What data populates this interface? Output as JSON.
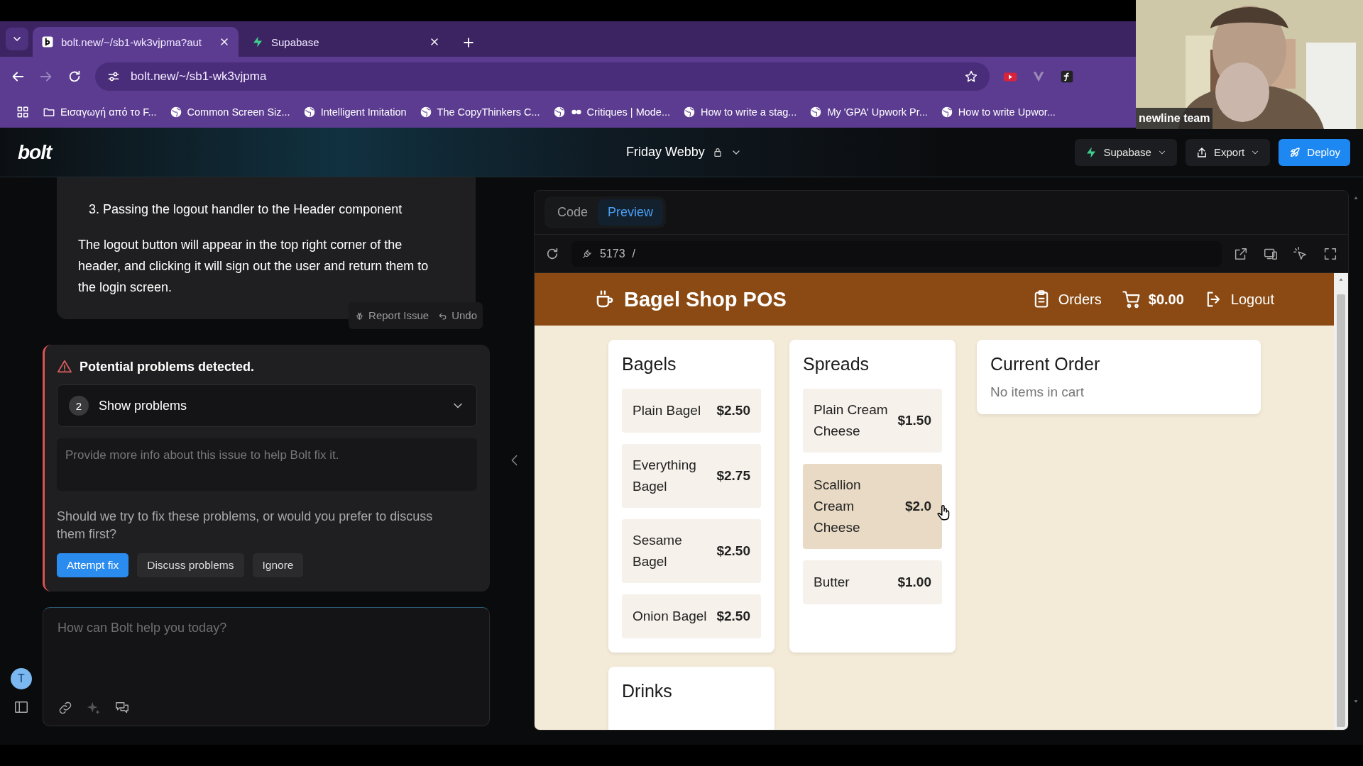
{
  "browser": {
    "tabs": [
      {
        "title": "bolt.new/~/sb1-wk3vjpma?aut",
        "kind": "bolt",
        "selected": true
      },
      {
        "title": "Supabase",
        "kind": "supabase",
        "selected": false
      }
    ],
    "address": "bolt.new/~/sb1-wk3vjpma",
    "bookmarks": [
      {
        "label": "Εισαγωγή από το F...",
        "kind": "folder"
      },
      {
        "label": "Common Screen Siz...",
        "kind": "globe"
      },
      {
        "label": "Intelligent Imitation",
        "kind": "globe"
      },
      {
        "label": "The CopyThinkers C...",
        "kind": "globe"
      },
      {
        "label": "Critiques | Mode...",
        "kind": "globe-mask"
      },
      {
        "label": "How to write a stag...",
        "kind": "globe"
      },
      {
        "label": "My 'GPA' Upwork Pr...",
        "kind": "globe"
      },
      {
        "label": "How to write Upwor...",
        "kind": "globe"
      }
    ]
  },
  "webcam": {
    "kind": "picture",
    "caption": "newline team"
  },
  "header": {
    "logo": "bolt",
    "project": "Friday Webby",
    "buttons": [
      {
        "label": "Supabase",
        "kind": "supabase"
      },
      {
        "label": "Export",
        "kind": "export"
      },
      {
        "label": "Deploy",
        "kind": "deploy"
      }
    ]
  },
  "chat": {
    "message": {
      "list_item": "3. Passing the logout handler to the Header component",
      "paragraph": "The logout button will appear in the top right corner of the header, and clicking it will sign out the user and return them to the login screen.",
      "actions": [
        {
          "label": "Report Issue",
          "kind": "report"
        },
        {
          "label": "Undo",
          "kind": "undo"
        }
      ]
    },
    "alert": {
      "title": "Potential problems detected.",
      "count": "2",
      "toggle": "Show problems",
      "expanded": false,
      "placeholder": "Provide more info about this issue to help Bolt fix it.",
      "question": "Should we try to fix these problems, or would you prefer to discuss them first?",
      "buttons": [
        {
          "label": "Attempt fix",
          "primary": true
        },
        {
          "label": "Discuss problems",
          "primary": false
        },
        {
          "label": "Ignore",
          "primary": false
        }
      ]
    },
    "input": {
      "placeholder": "How can Bolt help you today?"
    },
    "avatar": "T"
  },
  "workbench": {
    "tabs": [
      {
        "label": "Code",
        "selected": false
      },
      {
        "label": "Preview",
        "selected": true
      }
    ],
    "port": "5173",
    "path": "/",
    "app": {
      "title": "Bagel Shop POS",
      "nav": [
        {
          "label": "Orders",
          "kind": "orders"
        },
        {
          "label": "$0.00",
          "kind": "cart"
        },
        {
          "label": "Logout",
          "kind": "logout"
        }
      ],
      "menu": [
        {
          "title": "Bagels",
          "items": [
            {
              "name": "Plain Bagel",
              "price": "$2.50",
              "hovered": false
            },
            {
              "name": "Everything Bagel",
              "price": "$2.75",
              "hovered": false
            },
            {
              "name": "Sesame Bagel",
              "price": "$2.50",
              "hovered": false
            },
            {
              "name": "Onion Bagel",
              "price": "$2.50",
              "hovered": false
            }
          ]
        },
        {
          "title": "Spreads",
          "items": [
            {
              "name": "Plain Cream Cheese",
              "price": "$1.50",
              "hovered": false
            },
            {
              "name": "Scallion Cream Cheese",
              "price": "$2.0",
              "hovered": true
            },
            {
              "name": "Butter",
              "price": "$1.00",
              "hovered": false
            }
          ]
        },
        {
          "title": "Drinks"
        }
      ],
      "order": {
        "title": "Current Order",
        "empty_text": "No items in cart"
      }
    }
  }
}
